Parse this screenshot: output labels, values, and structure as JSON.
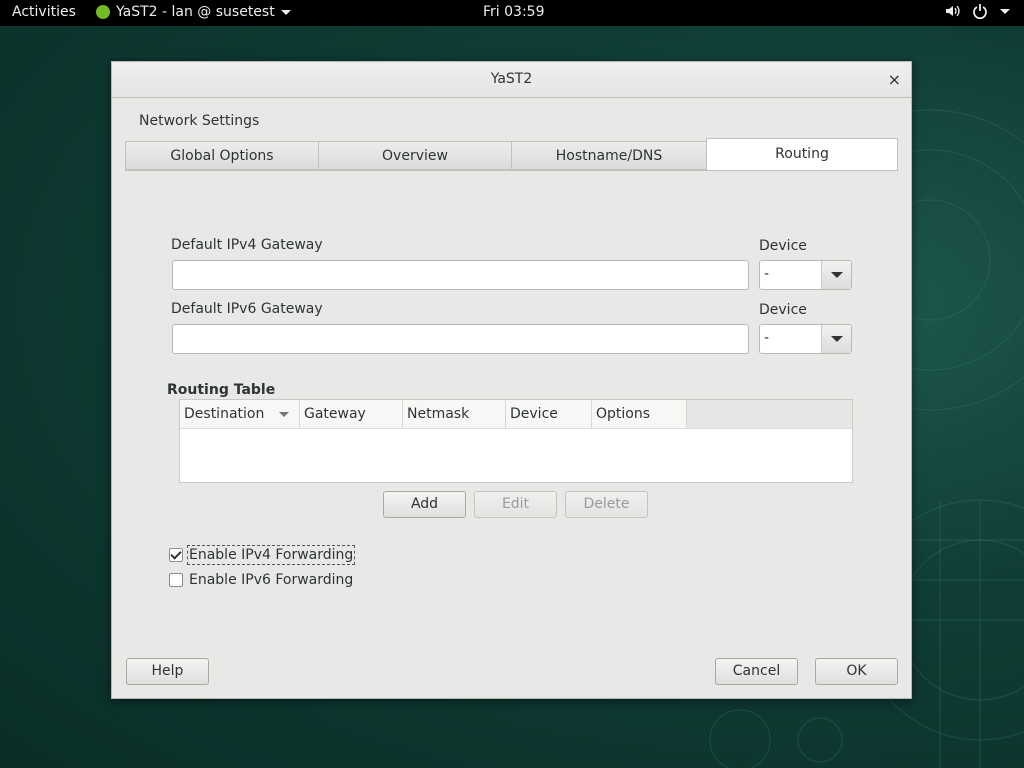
{
  "topbar": {
    "activities": "Activities",
    "app_menu": "YaST2 - lan @ susetest",
    "clock": "Fri 03:59"
  },
  "window": {
    "title": "YaST2",
    "close_glyph": "×",
    "section_title": "Network Settings",
    "tabs": [
      {
        "label": "Global Options"
      },
      {
        "label": "Overview"
      },
      {
        "label": "Hostname/DNS"
      },
      {
        "label": "Routing",
        "active": true
      }
    ]
  },
  "routing": {
    "ipv4_gateway_label": "Default IPv4 Gateway",
    "ipv4_gateway_value": "",
    "ipv4_device_label": "Device",
    "ipv4_device_value": "-",
    "ipv6_gateway_label": "Default IPv6 Gateway",
    "ipv6_gateway_value": "",
    "ipv6_device_label": "Device",
    "ipv6_device_value": "-",
    "table_title": "Routing Table",
    "columns": [
      "Destination",
      "Gateway",
      "Netmask",
      "Device",
      "Options"
    ],
    "rows": [],
    "add_label": "Add",
    "edit_label": "Edit",
    "delete_label": "Delete",
    "ipv4_forwarding_label": "Enable IPv4 Forwarding",
    "ipv4_forwarding_checked": true,
    "ipv6_forwarding_label": "Enable IPv6 Forwarding",
    "ipv6_forwarding_checked": false
  },
  "footer": {
    "help_label": "Help",
    "cancel_label": "Cancel",
    "ok_label": "OK"
  }
}
